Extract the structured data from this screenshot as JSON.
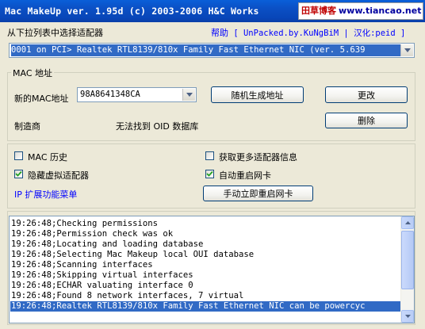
{
  "window": {
    "title": "Mac MakeUp ver. 1.95d (c) 2003-2006 H&C Works",
    "watermark_cn": "田草博客",
    "watermark_url": "www.tiancao.net"
  },
  "adapter_section": {
    "label": "从下拉列表中选择适配器",
    "help_link": "帮助",
    "credit_open": "[",
    "credit_unpacked": "UnPacked.by.KuNgBiM",
    "credit_sep": "|",
    "credit_cn": "汉化:peid",
    "credit_close": "]",
    "selected_adapter": "0001 on PCI> Realtek RTL8139/810x Family Fast Ethernet NIC (ver. 5.639"
  },
  "mac_group": {
    "title": "MAC 地址",
    "new_mac_label": "新的MAC地址",
    "new_mac_value": "98A8641348CA",
    "random_button": "随机生成地址",
    "change_button": "更改",
    "manufacturer_label": "制造商",
    "manufacturer_value": "无法找到 OID 数据库",
    "remove_button": "删除"
  },
  "options": {
    "mac_history": {
      "label": "MAC 历史",
      "checked": false
    },
    "more_info": {
      "label": "获取更多适配器信息",
      "checked": false
    },
    "hide_virtual": {
      "label": "隐藏虚拟适配器",
      "checked": true
    },
    "auto_restart": {
      "label": "自动重启网卡",
      "checked": true
    },
    "ip_menu_link": "IP 扩展功能菜单",
    "manual_restart_button": "手动立即重启网卡"
  },
  "log": {
    "lines": [
      "19:26:48;Checking permissions",
      "19:26:48;Permission check was ok",
      "19:26:48;Locating and loading database",
      "19:26:48;Selecting Mac Makeup local OUI database",
      "19:26:48;Scanning interfaces",
      "19:26:48;Skipping virtual interfaces",
      "19:26:48;ECHAR valuating interface 0",
      "19:26:48;Found 8 network interfaces, 7 virtual",
      "19:26:48;Realtek RTL8139/810x Family Fast Ethernet NIC can be powercyc"
    ],
    "selected_index": 8
  },
  "colors": {
    "titlebar": "#0a4fc4",
    "selection": "#316ac5",
    "face": "#ece9d8",
    "link": "#0000ff"
  }
}
